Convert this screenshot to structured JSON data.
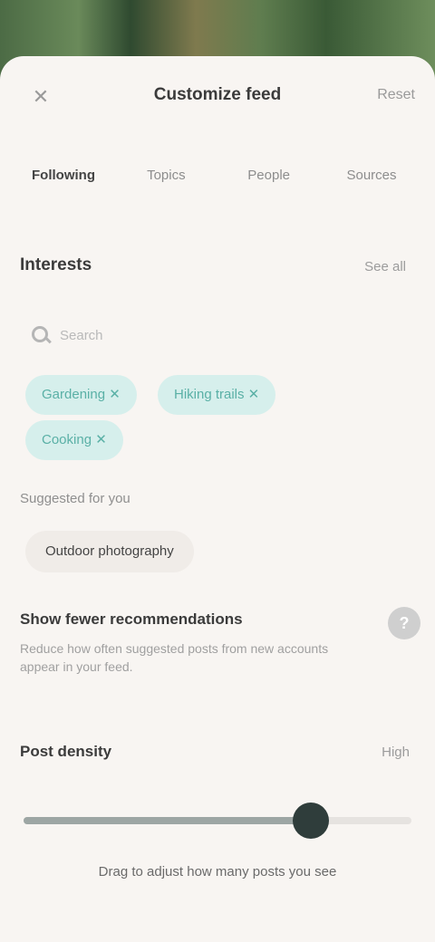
{
  "sheet": {
    "title": "Customize feed",
    "close_icon": "✕",
    "action": "Reset"
  },
  "tabs": [
    {
      "label": "Following"
    },
    {
      "label": "Topics"
    },
    {
      "label": "People"
    },
    {
      "label": "Sources"
    }
  ],
  "topics": {
    "title": "Interests",
    "link": "See all",
    "search_placeholder": "Search",
    "chips": [
      "Gardening ✕",
      "Hiking trails ✕",
      "Cooking ✕"
    ]
  },
  "suggested": {
    "label": "Suggested for you",
    "pill": "Outdoor photography"
  },
  "setting": {
    "title": "Show fewer recommendations",
    "description": "Reduce how often suggested posts from new accounts appear in your feed.",
    "help_icon": "?"
  },
  "slider": {
    "title": "Post density",
    "value_label": "High",
    "value": 0.74,
    "caption": "Drag to adjust how many posts you see"
  }
}
